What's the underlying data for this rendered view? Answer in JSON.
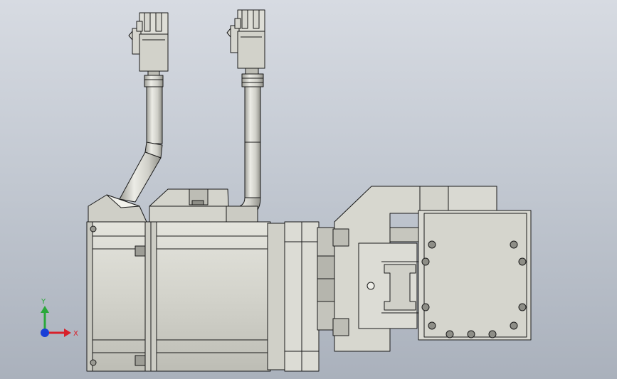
{
  "viewport": {
    "background_top": "#d7dbe2",
    "background_bottom": "#aab1bc"
  },
  "model": {
    "part_fill": "#d6d6cf",
    "part_shade": "#b9b9b1",
    "edge_color": "#1a1a1a"
  },
  "triad": {
    "x_label": "X",
    "y_label": "Y",
    "x_color": "#d8202a",
    "y_color": "#2aa83a",
    "z_color": "#1a3fd6"
  }
}
